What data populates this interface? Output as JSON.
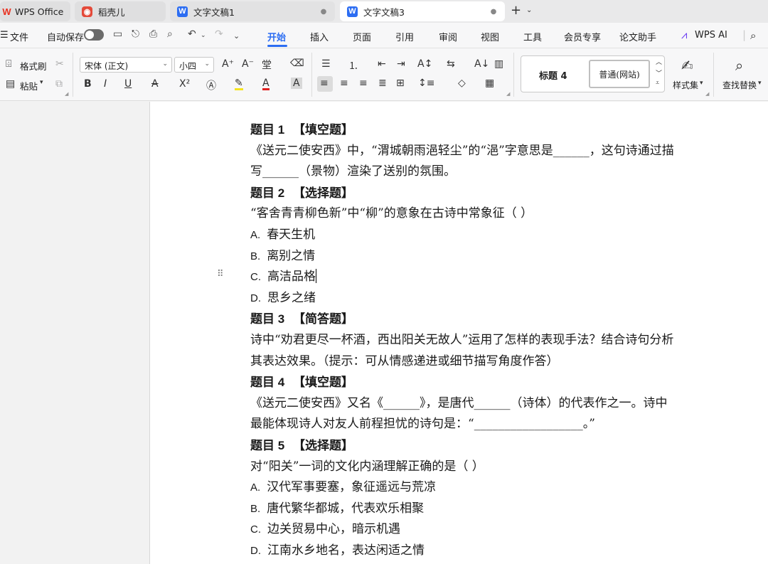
{
  "tabs": [
    {
      "label": "WPS Office",
      "icon": "wps-logo-icon"
    },
    {
      "label": "稻壳儿",
      "icon": "docer-icon"
    },
    {
      "label": "文字文稿1",
      "icon": "w-doc-icon"
    },
    {
      "label": "文字文稿3",
      "icon": "w-doc-icon",
      "active": true
    }
  ],
  "menu": {
    "file": "文件",
    "autosave": "自动保存",
    "items": [
      "开始",
      "插入",
      "页面",
      "引用",
      "审阅",
      "视图",
      "工具",
      "会员专享",
      "论文助手",
      "WPS AI"
    ],
    "active": "开始"
  },
  "ribbon": {
    "format_painter": "格式刷",
    "paste": "粘贴",
    "font_name": "宋体 (正文)",
    "font_size": "小四",
    "style_heading4": "标题 4",
    "style_normal": "普通(网站)",
    "style_set": "样式集",
    "find_replace": "查找替换"
  },
  "document": {
    "q1_head": {
      "num": "题目 1",
      "type": "【填空题】"
    },
    "q1_l1": "《送元二使安西》中，“渭城朝雨浥轻尘”的“浥”字意思是______，这句诗通过描",
    "q1_l2": "写______（景物）渲染了送别的氛围。",
    "q2_head": {
      "num": "题目 2",
      "type": "【选择题】"
    },
    "q2_stem": "“客舍青青柳色新”中“柳”的意象在古诗中常象征（ ）",
    "q2_opts": [
      {
        "letter": "A.",
        "text": "春天生机"
      },
      {
        "letter": "B.",
        "text": "离别之情"
      },
      {
        "letter": "C.",
        "text": "高洁品格"
      },
      {
        "letter": "D.",
        "text": "思乡之绪"
      }
    ],
    "q3_head": {
      "num": "题目 3",
      "type": "【简答题】"
    },
    "q3_l1": "诗中“劝君更尽一杯酒，西出阳关无故人”运用了怎样的表现手法？结合诗句分析",
    "q3_l2": "其表达效果。（提示：可从情感递进或细节描写角度作答）",
    "q4_head": {
      "num": "题目 4",
      "type": "【填空题】"
    },
    "q4_l1": "《送元二使安西》又名《______》，是唐代______（诗体）的代表作之一。诗中",
    "q4_l2": "最能体现诗人对友人前程担忧的诗句是：“__________________。”",
    "q5_head": {
      "num": "题目 5",
      "type": "【选择题】"
    },
    "q5_stem": "对“阳关”一词的文化内涵理解正确的是（ ）",
    "q5_opts": [
      {
        "letter": "A.",
        "text": "汉代军事要塞，象征遥远与荒凉"
      },
      {
        "letter": "B.",
        "text": "唐代繁华都城，代表欢乐相聚"
      },
      {
        "letter": "C.",
        "text": "边关贸易中心，暗示机遇"
      },
      {
        "letter": "D.",
        "text": "江南水乡地名，表达闲适之情"
      }
    ]
  },
  "colors": {
    "accent": "#2c6df2",
    "wps_red": "#e9301f"
  }
}
